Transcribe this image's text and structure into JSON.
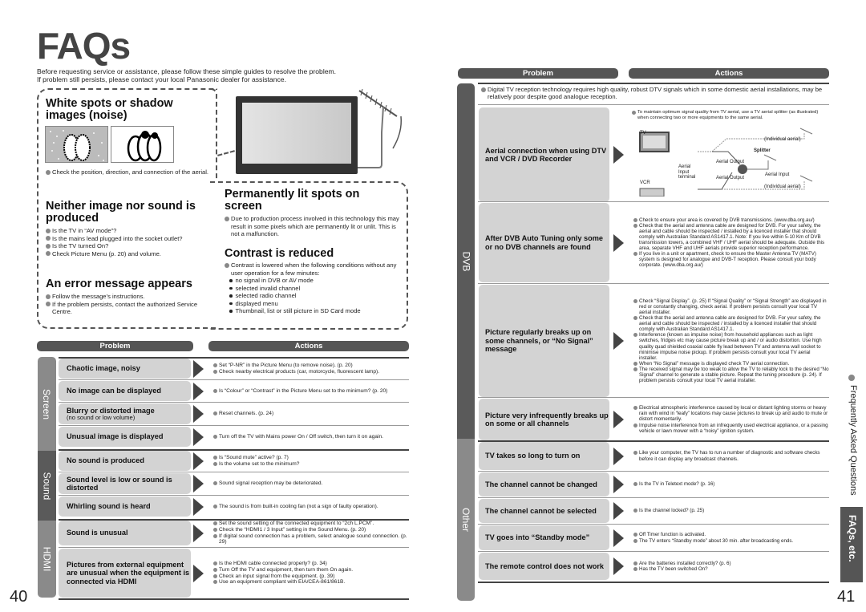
{
  "page": {
    "title": "FAQs",
    "intro": [
      "Before requesting service or assistance, please follow these simple guides to resolve the problem.",
      "If problem still persists, please contact your local Panasonic dealer for assistance."
    ],
    "page_left": "40",
    "page_right": "41"
  },
  "tips": {
    "white_spots": {
      "title": "White spots or shadow images (noise)",
      "bullets": [
        "Check the position, direction, and connection of the aerial."
      ]
    },
    "neither": {
      "title": "Neither image nor sound is produced",
      "bullets": [
        "Is the TV in “AV mode”?",
        "Is the mains lead plugged into the socket outlet?",
        "Is the TV turned On?",
        "Check Picture Menu (p. 20) and volume."
      ]
    },
    "error": {
      "title": "An error message appears",
      "bullets": [
        "Follow the message’s instructions.",
        "If the problem persists, contact the authorized Service Centre."
      ]
    },
    "lit_spots": {
      "title": "Permanently lit spots on screen",
      "bullets": [
        "Due to production process involved in this technology this may result in some pixels which are permanently lit or unlit. This is not a malfunction."
      ]
    },
    "contrast": {
      "title": "Contrast is reduced",
      "bullets": [
        "Contrast is lowered when the following conditions without any user operation for a few minutes:"
      ],
      "sub": [
        "no signal in DVB or AV mode",
        "selected invalid channel",
        "selected radio channel",
        "displayed menu",
        "Thumbnail, list or still picture in SD Card mode"
      ]
    }
  },
  "left_table": {
    "headers": {
      "problem": "Problem",
      "actions": "Actions"
    },
    "categories": [
      "Screen",
      "Sound",
      "HDMI"
    ],
    "rows": [
      {
        "problem": "Chaotic image, noisy",
        "actions": [
          "Set “P-NR” in the Picture Menu (to remove noise). (p. 20)",
          "Check nearby electrical products (car, motorcycle, fluorescent lamp)."
        ]
      },
      {
        "problem": "No image can be displayed",
        "actions": [
          "Is “Colour” or “Contrast” in the Picture Menu set to the minimum? (p. 20)"
        ]
      },
      {
        "problem": "Blurry or distorted image",
        "sub": "(no sound or low volume)",
        "actions": [
          "Reset channels. (p. 24)"
        ]
      },
      {
        "problem": "Unusual image is displayed",
        "actions": [
          "Turn off the TV with Mains power On / Off switch, then turn it on again."
        ]
      },
      {
        "problem": "No sound is produced",
        "actions": [
          "Is “Sound mute” active? (p. 7)",
          "Is the volume set to the minimum?"
        ]
      },
      {
        "problem": "Sound level is low or sound is distorted",
        "actions": [
          "Sound signal reception may be deteriorated."
        ]
      },
      {
        "problem": "Whirling sound is heard",
        "actions": [
          "The sound is from built-in cooling fan (not a sign of faulty operation)."
        ]
      },
      {
        "problem": "Sound is unusual",
        "actions": [
          "Set the sound setting of the connected equipment to “2ch L.PCM”.",
          "Check the “HDMI1 / 3 Input” setting in the Sound Menu. (p. 20)",
          "If digital sound connection has a problem, select analogue sound connection. (p. 29)"
        ]
      },
      {
        "problem": "Pictures from external equipment are unusual when the equipment is connected via HDMI",
        "actions": [
          "Is the HDMI cable connected properly? (p. 34)",
          "Turn Off the TV and equipment, then turn them On again.",
          "Check an input signal from the equipment. (p. 39)",
          "Use an equipment compliant with EIA/CEA-861/861B."
        ]
      }
    ]
  },
  "right_table": {
    "headers": {
      "problem": "Problem",
      "actions": "Actions"
    },
    "categories": [
      "DVB",
      "Other"
    ],
    "dvb_note": "Digital TV reception technology requires high quality, robust DTV signals which in some domestic aerial installations, may be relatively poor despite good analogue reception.",
    "diagram": {
      "note": "To maintain optimum signal quality from TV aerial, use a TV aerial splitter (as illustrated) when connecting two or more equipments to the same aerial.",
      "labels": {
        "tv": "TV",
        "vcr": "VCR",
        "splitter": "Splitter",
        "aerial_output_1": "Aerial Output",
        "aerial_output_2": "Aerial Output",
        "aerial_input": "Aerial Input",
        "aerial_input_terminal": "Aerial Input terminal",
        "individual_aerial_1": "(Individual aerial)",
        "individual_aerial_2": "(Individual aerial)"
      }
    },
    "rows": [
      {
        "problem": "Aerial connection when using DTV and VCR / DVD Recorder",
        "actions": []
      },
      {
        "problem": "After DVB Auto Tuning only some or no DVB channels are found",
        "actions": [
          "Check to ensure your area is covered by DVB transmissions. (www.dba.org.au/)",
          "Check that the aerial and antenna cable are designed for DVB. For your safety, the aerial and cable should be inspected / installed by a licenced installer that should comply with Australian Standard AS1417.1. Note: If you live within 5-10 Km of DVB transmission towers, a combined VHF / UHF aerial should be adequate. Outside this area, separate VHF and UHF aerials provide superior reception performance.",
          "If you live in a unit or apartment, check to ensure the Master Antenna TV (MATV) system is designed for analogue and DVB-T reception. Please consult your body corporate. (www.dba.org.au/)"
        ]
      },
      {
        "problem": "Picture regularly breaks up on some channels, or “No Signal” message",
        "actions": [
          "Check “Signal Display”. (p. 25) If “Signal Quality” or “Signal Strength” are displayed in red or constantly changing, check aerial. If problem persists consult your local TV aerial installer.",
          "Check that the aerial and antenna cable are designed for DVB. For your safety, the aerial and cable should be inspected / installed by a licenced installer that should comply with Australian Standard AS1417.1.",
          "Interference (known as impulse noise) from household appliances such as light switches, fridges etc may cause picture break up and / or audio distortion. Use high quality quad shielded coaxial cable fly lead between TV and antenna wall socket to minimise impulse noise pickup. If problem persists consult your local TV aerial installer.",
          "When “No Signal” message is displayed check TV aerial connection.",
          "The received signal may be too weak to allow the TV to reliably lock to the desired “No Signal” channel to generate a stable picture. Repeat the tuning procedure (p. 24). If problem persists consult your local TV aerial installer."
        ]
      },
      {
        "problem": "Picture very infrequently breaks up on some or all channels",
        "actions": [
          "Electrical atmospheric interference caused by local or distant lighting storms or heavy rain with wind in “leafy” locations may cause pictures to break up and audio to mute or distort momentarily.",
          "Impulse noise interference from an infrequently used electrical appliance, or a passing vehicle or lawn mower with a “noisy” ignition system."
        ]
      },
      {
        "problem": "TV takes so long to turn on",
        "actions": [
          "Like your computer, the TV has to run a number of diagnostic and software checks before it can display any broadcast channels."
        ]
      },
      {
        "problem": "The channel cannot be changed",
        "actions": [
          "Is the TV in Teletext mode? (p. 16)"
        ]
      },
      {
        "problem": "The channel cannot be selected",
        "actions": [
          "Is the channel locked? (p. 25)"
        ]
      },
      {
        "problem": "TV goes into “Standby mode”",
        "actions": [
          "Off Timer function is activated.",
          "The TV enters “Standby mode” about 30 min. after broadcasting ends."
        ]
      },
      {
        "problem": "The remote control does not work",
        "actions": [
          "Are the batteries installed correctly? (p. 6)",
          "Has the TV been switched On?"
        ]
      }
    ]
  },
  "side_tab": {
    "section": "Frequently Asked Questions",
    "chapter": "FAQs, etc."
  },
  "colors": {
    "dark_header": "#555555",
    "problem_cell": "#d3d3d3",
    "cat_screen": "#8a8a8a",
    "cat_sound": "#5a5a5a",
    "cat_hdmi": "#8a8a8a"
  }
}
